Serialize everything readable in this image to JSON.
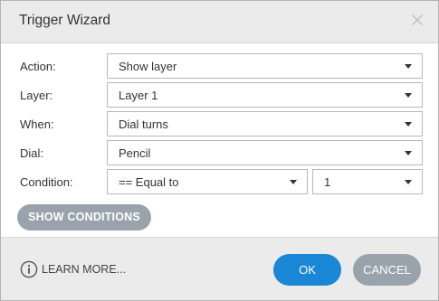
{
  "dialog": {
    "title": "Trigger Wizard",
    "close_icon": "close-icon"
  },
  "fields": {
    "action": {
      "label": "Action:",
      "value": "Show layer"
    },
    "layer": {
      "label": "Layer:",
      "value": "Layer 1"
    },
    "when": {
      "label": "When:",
      "value": "Dial turns"
    },
    "dial": {
      "label": "Dial:",
      "value": "Pencil"
    },
    "condition": {
      "label": "Condition:",
      "operator": "== Equal to",
      "value": "1"
    }
  },
  "show_conditions_label": "SHOW CONDITIONS",
  "footer": {
    "learn_more_label": "LEARN MORE...",
    "info_icon": "info-icon",
    "ok_label": "OK",
    "cancel_label": "CANCEL"
  },
  "colors": {
    "primary": "#1a86d6",
    "secondary": "#9aa3ab",
    "chrome": "#ebebeb"
  }
}
